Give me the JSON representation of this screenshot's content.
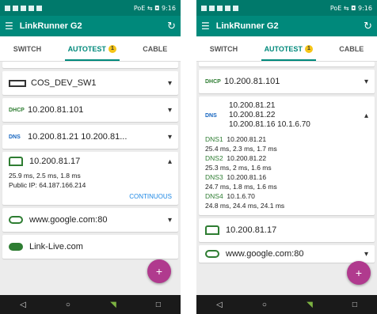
{
  "left": {
    "status": {
      "right": "PoE ⇆ ◘ 9:16"
    },
    "appbar": {
      "title": "LinkRunner G2"
    },
    "tabs": [
      {
        "label": "SWITCH"
      },
      {
        "label": "AUTOTEST",
        "badge": "1"
      },
      {
        "label": "CABLE"
      }
    ],
    "cards": {
      "switch": "COS_DEV_SW1",
      "dhcp_tag": "DHCP",
      "dhcp": "10.200.81.101",
      "dns_tag": "DNS",
      "dns": "10.200.81.21  10.200.81...",
      "gateway": "10.200.81.17",
      "gateway_times": "25.9 ms, 2.5 ms, 1.8 ms",
      "public_ip": "Public IP: 64.187.166.214",
      "continuous": "CONTINUOUS",
      "target": "www.google.com:80",
      "linklive": "Link-Live.com"
    },
    "fab": "+"
  },
  "right": {
    "status": {
      "right": "PoE ⇆ ◘ 9:16"
    },
    "appbar": {
      "title": "LinkRunner G2"
    },
    "tabs": [
      {
        "label": "SWITCH"
      },
      {
        "label": "AUTOTEST",
        "badge": "1"
      },
      {
        "label": "CABLE"
      }
    ],
    "dhcp_tag": "DHCP",
    "dhcp": "10.200.81.101",
    "dns_tag": "DNS",
    "dns_list": [
      "10.200.81.21",
      "10.200.81.22",
      "10.200.81.16  10.1.6.70"
    ],
    "dns_entries": [
      {
        "name": "DNS1",
        "ip": "10.200.81.21",
        "times": "25.4 ms, 2.3 ms, 1.7 ms"
      },
      {
        "name": "DNS2",
        "ip": "10.200.81.22",
        "times": "25.3 ms, 2 ms, 1.6 ms"
      },
      {
        "name": "DNS3",
        "ip": "10.200.81.16",
        "times": "24.7 ms, 1.8 ms, 1.6 ms"
      },
      {
        "name": "DNS4",
        "ip": "10.1.6.70",
        "times": "24.8 ms, 24.4 ms, 24.1 ms"
      }
    ],
    "gateway": "10.200.81.17",
    "target": "www.google.com:80",
    "fab": "+"
  },
  "colors": {
    "accent": "#00897b",
    "fab": "#b03a8e",
    "green": "#2e7d32",
    "link": "#1e88e5"
  }
}
